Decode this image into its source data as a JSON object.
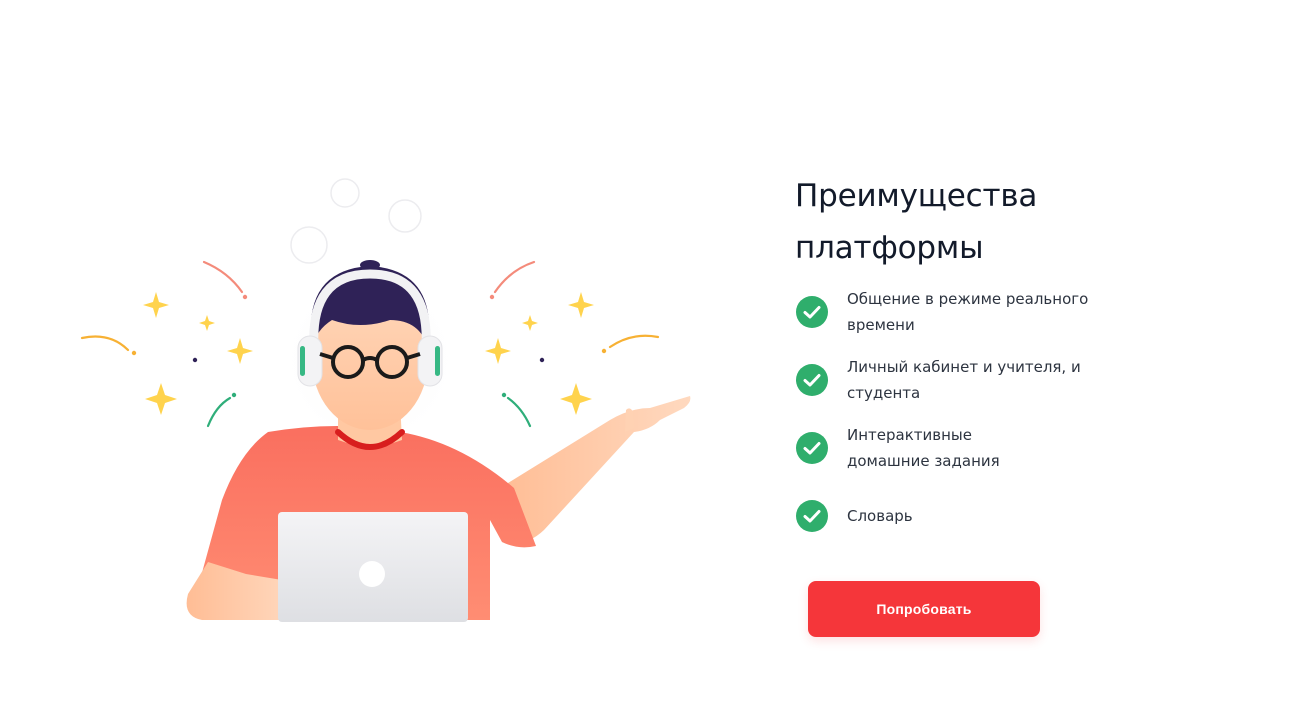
{
  "benefits": {
    "title": "Преимущества платформы",
    "items": [
      {
        "text": "Общение в режиме реального времени",
        "icon": "check-circle-icon"
      },
      {
        "text": "Личный кабинет и учителя, и студента",
        "icon": "check-circle-icon"
      },
      {
        "text": "Интерактивные домашние задания",
        "icon": "check-circle-icon"
      },
      {
        "text": "Словарь",
        "icon": "check-circle-icon"
      }
    ],
    "cta_label": "Попробовать"
  },
  "illustration": {
    "subject": "student-with-headphones-and-laptop"
  },
  "colors": {
    "accent": "#f5363a",
    "check": "#2fae6c",
    "title": "#121a2a",
    "text": "#2d3440",
    "shirt": "#fb7a68",
    "hair": "#2f2257",
    "skin": "#ffc8a2",
    "star": "#ffd34d"
  }
}
